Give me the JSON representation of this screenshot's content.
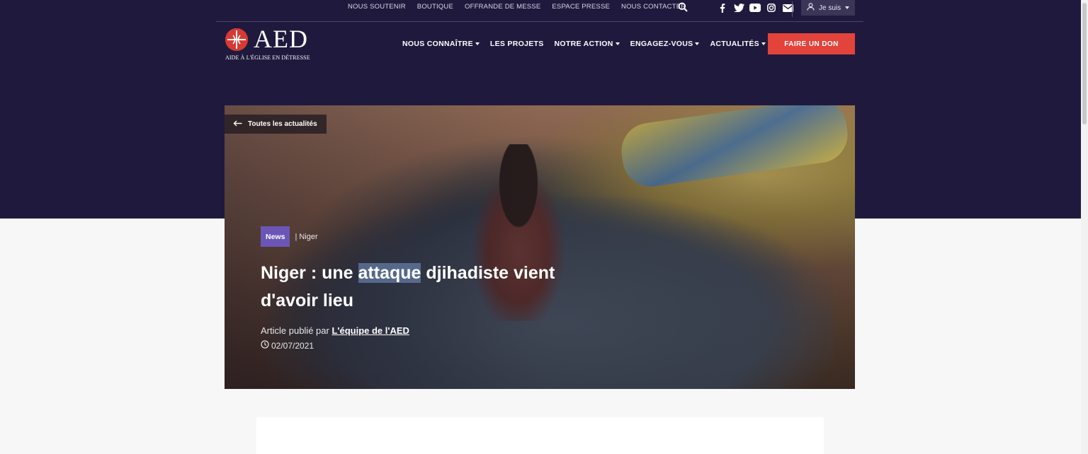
{
  "topbar": {
    "links": [
      "NOUS SOUTENIR",
      "BOUTIQUE",
      "OFFRANDE DE MESSE",
      "ESPACE PRESSE",
      "NOUS CONTACTER"
    ],
    "user_menu_label": "Je suis"
  },
  "logo": {
    "name": "AED",
    "subtitle": "AIDE À L'ÉGLISE EN DÉTRESSE"
  },
  "nav": {
    "items": [
      {
        "label": "NOUS CONNAÎTRE",
        "dropdown": true
      },
      {
        "label": "LES PROJETS",
        "dropdown": false
      },
      {
        "label": "NOTRE ACTION",
        "dropdown": true
      },
      {
        "label": "ENGAGEZ-VOUS",
        "dropdown": true
      },
      {
        "label": "ACTUALITÉS",
        "dropdown": true
      }
    ],
    "donate_label": "FAIRE UN DON"
  },
  "article": {
    "back_label": "Toutes les actualités",
    "category": "News",
    "location": "| Niger",
    "title_before": "Niger : une ",
    "title_highlight": "attaque",
    "title_after": " djihadiste vient d'avoir lieu",
    "byline_prefix": "Article publié par ",
    "author": "L'équipe de l'AED",
    "date": "02/07/2021"
  },
  "colors": {
    "navy": "#1f1a3d",
    "donate": "#e2433b",
    "tag": "#6b56b8",
    "logo_red": "#d63a33"
  },
  "icons": [
    "search-icon",
    "facebook-icon",
    "twitter-icon",
    "youtube-icon",
    "instagram-icon",
    "mail-icon",
    "user-icon",
    "arrow-left-icon",
    "clock-icon"
  ]
}
